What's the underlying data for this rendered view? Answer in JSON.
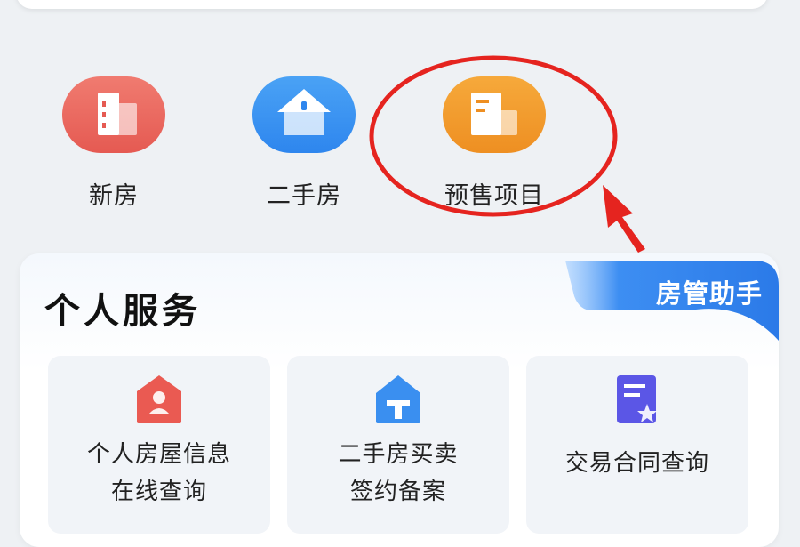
{
  "quick_nav": {
    "items": [
      {
        "label": "新房",
        "icon": "new-house-icon"
      },
      {
        "label": "二手房",
        "icon": "second-hand-house-icon"
      },
      {
        "label": "预售项目",
        "icon": "presale-project-icon"
      }
    ]
  },
  "panel": {
    "title": "个人服务",
    "tag": "房管助手"
  },
  "services": [
    {
      "line1": "个人房屋信息",
      "line2": "在线查询",
      "icon": "house-person-icon"
    },
    {
      "line1": "二手房买卖",
      "line2": "签约备案",
      "icon": "house-sign-icon"
    },
    {
      "line1": "交易合同查询",
      "line2": "",
      "icon": "contract-icon"
    }
  ],
  "colors": {
    "accent_red": "#e5241f",
    "new_house": "#ec6a61",
    "second_hand": "#3a93f2",
    "presale": "#f29c2e",
    "tag_blue": "#2f80ec"
  }
}
